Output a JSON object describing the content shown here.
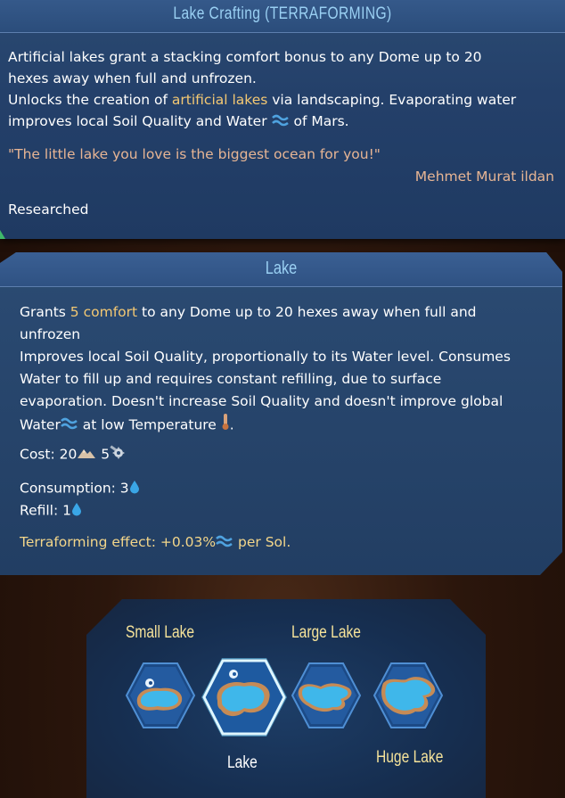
{
  "research": {
    "title": "Lake Crafting (TERRAFORMING)",
    "desc_1a": "Artificial lakes grant a stacking comfort bonus to any Dome up to 20",
    "desc_1b": "hexes away when full and unfrozen.",
    "desc_2a": "Unlocks the creation of ",
    "desc_2_hl": "artificial lakes",
    "desc_2b": " via landscaping. Evaporating water",
    "desc_3a": "improves local Soil Quality and  Water ",
    "desc_3b": " of Mars.",
    "quote": "\"The little lake you love is the biggest ocean for you!\"",
    "author": "Mehmet Murat ildan",
    "status": "Researched"
  },
  "building": {
    "title": "Lake",
    "grants_a": "Grants ",
    "grants_hl": "5 comfort",
    "grants_b": " to any Dome up to 20 hexes away when full and",
    "grants_c": "unfrozen",
    "improves_1": "Improves local Soil Quality, proportionally to its Water level. Consumes",
    "improves_2": "Water to fill up and requires constant refilling, due to surface",
    "improves_3": "evaporation. Doesn't increase Soil Quality and doesn't improve global",
    "improves_4a": "Water",
    "improves_4b": " at low Temperature ",
    "improves_4c": ".",
    "cost_label": "Cost: 20",
    "cost_b": " 5",
    "consumption": "Consumption: 3",
    "refill": "Refill: 1",
    "terra_a": "Terraforming effect: +0.03%",
    "terra_b": " per Sol."
  },
  "options": [
    {
      "label": "Small Lake",
      "selected": false
    },
    {
      "label": "Lake",
      "selected": true
    },
    {
      "label": "Large Lake",
      "selected": false
    },
    {
      "label": "Huge Lake",
      "selected": false
    }
  ],
  "icons": [
    "water-wave-icon",
    "temperature-icon",
    "concrete-icon",
    "machine-parts-icon",
    "water-drop-icon"
  ],
  "colors": {
    "accent_title": "#9ad0f3",
    "highlight": "#f3c873",
    "quote": "#e7b594",
    "option_label": "#f6e39a"
  }
}
